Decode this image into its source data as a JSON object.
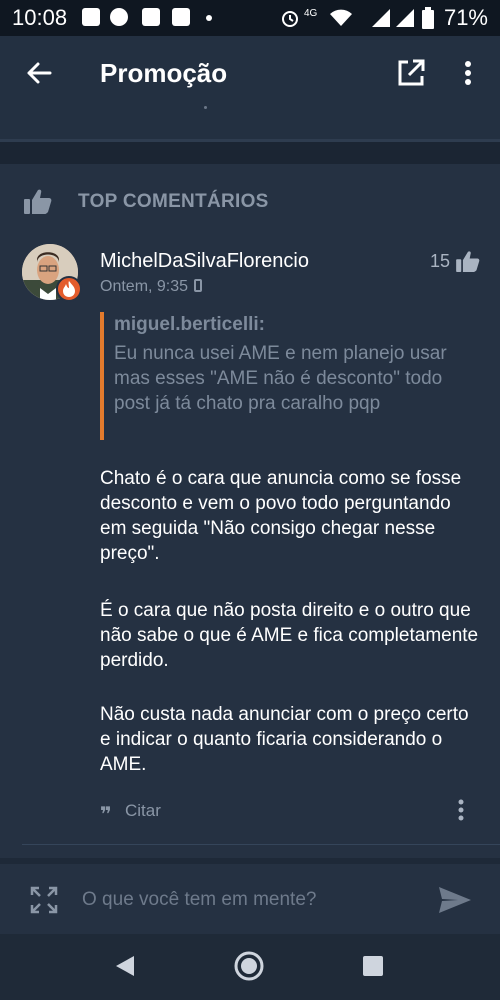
{
  "status_bar": {
    "time": "10:08",
    "network": "4G",
    "battery": "71%"
  },
  "app_bar": {
    "title": "Promoção"
  },
  "top_comments": {
    "label": "TOP COMENTÁRIOS"
  },
  "comment": {
    "author": "MichelDaSilvaFlorencio",
    "likes": "15",
    "timestamp": "Ontem, 9:35",
    "quote": {
      "author": "miguel.berticelli:",
      "text": "Eu nunca usei AME  e nem planejo usar mas esses \"AME não é desconto\" todo post já tá chato pra caralho pqp"
    },
    "paragraphs": [
      "Chato é o cara que anuncia como se fosse desconto e vem o povo todo perguntando em seguida \"Não consigo chegar nesse preço\".",
      "É o cara que não posta direito e o outro que não sabe o que é AME e fica completamente perdido.",
      "Não custa nada anunciar com o preço certo e indicar o quanto ficaria considerando o AME."
    ],
    "cite_label": "Citar"
  },
  "composer": {
    "placeholder": "O que você tem em mente?"
  },
  "colors": {
    "background": "#253142",
    "quote_accent": "#e37b2d",
    "muted_text": "#8a96a6"
  },
  "icons": {
    "back": "arrow-left-icon",
    "external": "open-external-icon",
    "more": "more-vert-icon",
    "thumb": "thumbs-up-icon",
    "cite": "quote-icon",
    "expand": "expand-icon",
    "send": "send-icon"
  }
}
